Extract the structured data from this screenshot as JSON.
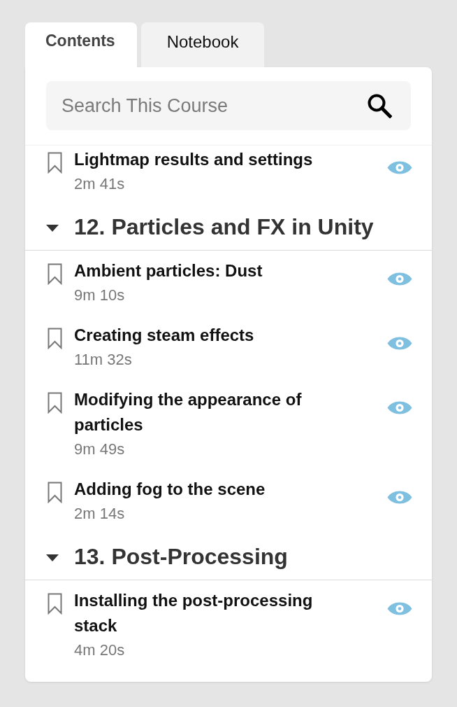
{
  "tabs": [
    {
      "label": "Contents",
      "selected": true
    },
    {
      "label": "Notebook",
      "selected": false
    }
  ],
  "search": {
    "placeholder": "Search This Course"
  },
  "outline": [
    {
      "kind": "lesson",
      "title": "Lightmap results and settings",
      "duration": "2m 41s",
      "bookmarked": false
    },
    {
      "kind": "section",
      "title": "12. Particles and FX in Unity",
      "expanded": true,
      "children": [
        {
          "kind": "lesson",
          "title": "Ambient particles: Dust",
          "duration": "9m 10s",
          "bookmarked": false
        },
        {
          "kind": "lesson",
          "title": "Creating steam effects",
          "duration": "11m 32s",
          "bookmarked": false
        },
        {
          "kind": "lesson",
          "title": "Modifying the appearance of particles",
          "duration": "9m 49s",
          "bookmarked": false
        },
        {
          "kind": "lesson",
          "title": "Adding fog to the scene",
          "duration": "2m 14s",
          "bookmarked": false
        }
      ]
    },
    {
      "kind": "section",
      "title": "13. Post-Processing",
      "expanded": true,
      "children": [
        {
          "kind": "lesson",
          "title": "Installing the post-processing stack",
          "duration": "4m 20s",
          "bookmarked": false
        }
      ]
    }
  ]
}
